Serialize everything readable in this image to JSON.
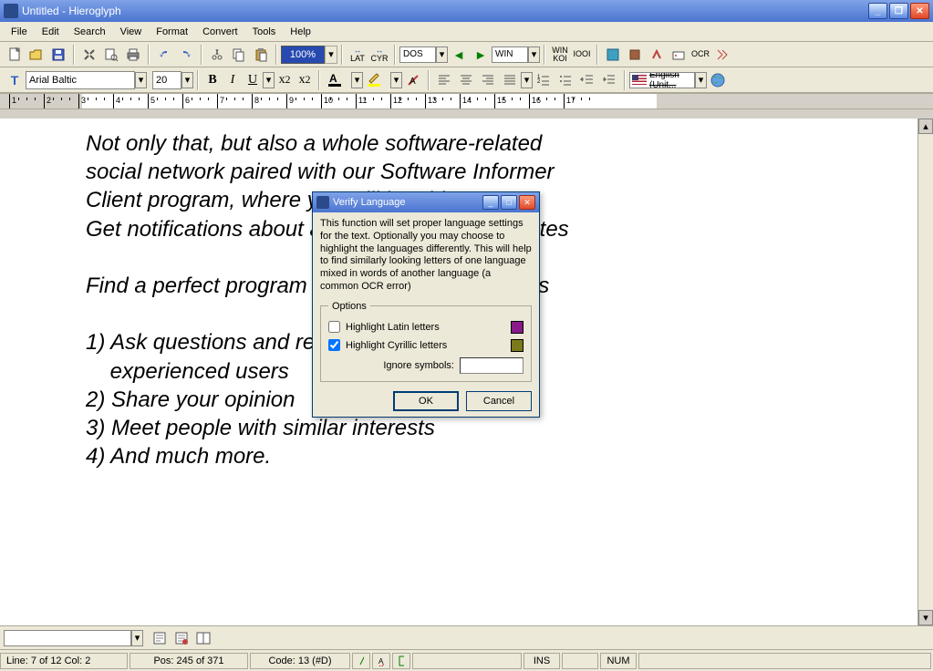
{
  "window": {
    "title": "Untitled - Hieroglyph"
  },
  "menubar": [
    "File",
    "Edit",
    "Search",
    "View",
    "Format",
    "Convert",
    "Tools",
    "Help"
  ],
  "toolbar1": {
    "zoom": "100%",
    "lat": "LAT",
    "cyr": "CYR",
    "enc1": "DOS",
    "enc2": "WIN",
    "koi": "KOI",
    "iooi": "IOOI",
    "ocr": "OCR"
  },
  "toolbar2": {
    "font_icon": "T",
    "font_name": "Arial Baltic",
    "font_size": "20",
    "bold": "B",
    "italic": "I",
    "underline": "U",
    "sub": "x",
    "sup": "x",
    "lang_label": "English (Unit..."
  },
  "ruler": [
    "1",
    "2",
    "3",
    "4",
    "5",
    "6",
    "7",
    "8",
    "9",
    "10",
    "11",
    "12",
    "13",
    "14",
    "15",
    "16",
    "17"
  ],
  "document": {
    "lines": [
      "Not only that, but also a whole software-related",
      "social network paired with our Software Informer",
      "Client program, where you will be able to:",
      "Get notifications about available software updates",
      "",
      "Find a perfect program for your particular needs",
      "",
      "1) Ask questions and receive answers from",
      "    experienced users",
      "2) Share your opinion",
      "3) Meet people with similar interests",
      "4) And much more."
    ]
  },
  "dialog": {
    "title": "Verify Language",
    "description": "This function will set proper language settings for the text. Optionally you may choose to highlight the languages differently. This will help to find similarly looking letters of one language mixed in words of another language (a common OCR error)",
    "options_label": "Options",
    "opt1_label": "Highlight Latin letters",
    "opt1_checked": false,
    "opt1_color": "#8a1a8a",
    "opt2_label": "Highlight Cyrillic letters",
    "opt2_checked": true,
    "opt2_color": "#7a7a1a",
    "ignore_label": "Ignore symbols:",
    "ignore_value": "",
    "ok": "OK",
    "cancel": "Cancel"
  },
  "statusbar": {
    "line_col": "Line: 7 of 12   Col: 2",
    "pos": "Pos: 245 of 371",
    "code": "Code: 13 (#D)",
    "ins": "INS",
    "num": "NUM"
  }
}
